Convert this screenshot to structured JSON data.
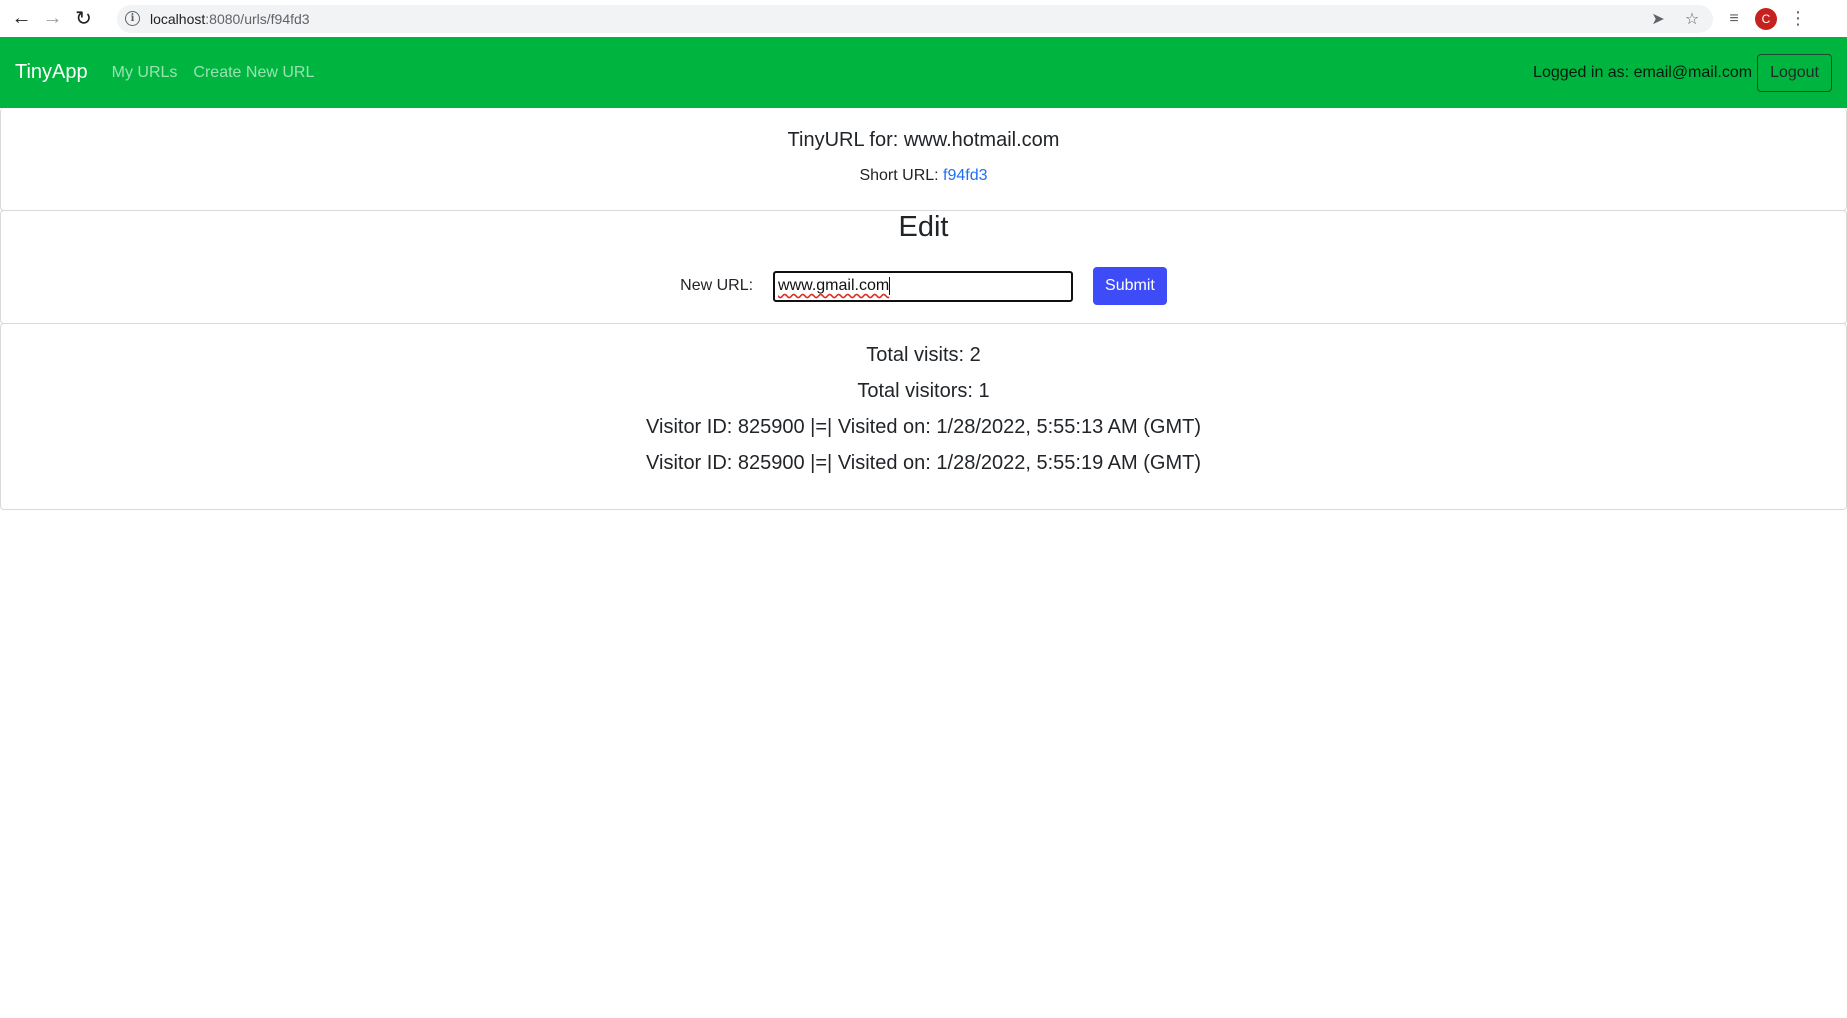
{
  "browser": {
    "url_host": "localhost",
    "url_path": ":8080/urls/f94fd3",
    "profile_initial": "C"
  },
  "navbar": {
    "brand": "TinyApp",
    "links": [
      "My URLs",
      "Create New URL"
    ],
    "logged_in_text": "Logged in as: email@mail.com",
    "logout_label": "Logout"
  },
  "header_card": {
    "title": "TinyURL for: www.hotmail.com",
    "short_url_label": "Short URL:",
    "short_url_value": "f94fd3"
  },
  "edit_card": {
    "title": "Edit",
    "new_url_label": "New URL:",
    "new_url_value": "www.gmail.com",
    "submit_label": "Submit"
  },
  "stats_card": {
    "total_visits": "Total visits: 2",
    "total_visitors": "Total visitors: 1",
    "visits": [
      "Visitor ID: 825900 |=| Visited on: 1/28/2022, 5:55:13 AM (GMT)",
      "Visitor ID: 825900 |=| Visited on: 1/28/2022, 5:55:19 AM (GMT)"
    ]
  },
  "colors": {
    "navbar_bg": "#00b53f",
    "submit_bg": "#3e4cf7",
    "link": "#1f6ff5"
  }
}
